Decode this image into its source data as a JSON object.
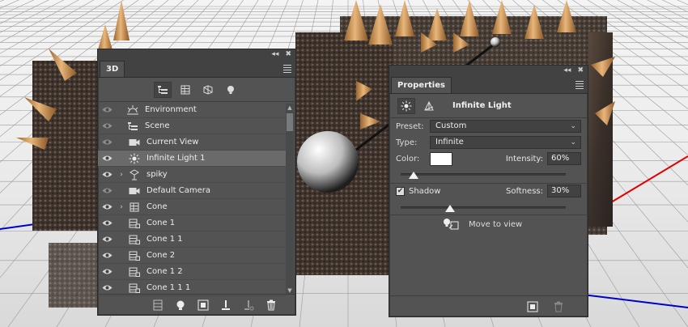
{
  "viewport": {
    "description_icon": "3d-scene-viewport"
  },
  "panel_3d": {
    "tab": "3D",
    "collapse_glyph": "◂◂",
    "close_glyph": "✖",
    "filters": [
      {
        "icon": "scene-filter-icon",
        "active": true
      },
      {
        "icon": "mesh-filter-icon",
        "active": false
      },
      {
        "icon": "material-filter-icon",
        "active": false
      },
      {
        "icon": "light-filter-icon",
        "active": false
      }
    ],
    "layers": [
      {
        "label": "Environment",
        "icon": "environment-icon",
        "indent": 0,
        "expander": "",
        "eye_dim": true,
        "selected": false
      },
      {
        "label": "Scene",
        "icon": "scene-icon",
        "indent": 0,
        "expander": "",
        "eye_dim": true,
        "selected": false
      },
      {
        "label": "Current View",
        "icon": "camera-icon",
        "indent": 1,
        "expander": "",
        "eye_dim": true,
        "selected": false
      },
      {
        "label": "Infinite Light 1",
        "icon": "infinite-light-icon",
        "indent": 1,
        "expander": "",
        "eye_dim": false,
        "selected": true
      },
      {
        "label": "spiky",
        "icon": "group-icon",
        "indent": 1,
        "expander": "›",
        "eye_dim": false,
        "selected": false
      },
      {
        "label": "Default Camera",
        "icon": "camera-icon",
        "indent": 1,
        "expander": "",
        "eye_dim": true,
        "selected": false
      },
      {
        "label": "Cone",
        "icon": "mesh-icon",
        "indent": 1,
        "expander": "›",
        "eye_dim": false,
        "selected": false
      },
      {
        "label": "Cone 1",
        "icon": "mesh-instance-icon",
        "indent": 1,
        "expander": "",
        "eye_dim": false,
        "selected": false
      },
      {
        "label": "Cone 1 1",
        "icon": "mesh-instance-icon",
        "indent": 1,
        "expander": "",
        "eye_dim": false,
        "selected": false
      },
      {
        "label": "Cone 2",
        "icon": "mesh-instance-icon",
        "indent": 1,
        "expander": "",
        "eye_dim": false,
        "selected": false
      },
      {
        "label": "Cone 1 2",
        "icon": "mesh-instance-icon",
        "indent": 1,
        "expander": "",
        "eye_dim": false,
        "selected": false
      },
      {
        "label": "Cone 1 1 1",
        "icon": "mesh-instance-icon",
        "indent": 1,
        "expander": "",
        "eye_dim": false,
        "selected": false
      }
    ],
    "toolbar": [
      "add-mesh-icon",
      "add-light-icon",
      "render-icon",
      "drop-to-plane-icon",
      "drop-to-plane-icon",
      "delete-icon"
    ]
  },
  "panel_props": {
    "tab": "Properties",
    "collapse_glyph": "◂◂",
    "close_glyph": "✖",
    "title": "Infinite Light",
    "preset_label": "Preset:",
    "preset_value": "Custom",
    "type_label": "Type:",
    "type_value": "Infinite",
    "color_label": "Color:",
    "color_value": "#ffffff",
    "intensity_label": "Intensity:",
    "intensity_value": "60%",
    "intensity_fraction": 0.08,
    "shadow_label": "Shadow",
    "shadow_checked": "✔",
    "softness_label": "Softness:",
    "softness_value": "30%",
    "softness_fraction": 0.3,
    "move_to_view": "Move to view"
  },
  "colors": {
    "panel_bg": "#535353",
    "panel_dark": "#424242",
    "selected_row": "#6a6a6a",
    "cone_orange": "#c88a47",
    "axis_red": "#e00000",
    "axis_blue": "#0000cc"
  }
}
